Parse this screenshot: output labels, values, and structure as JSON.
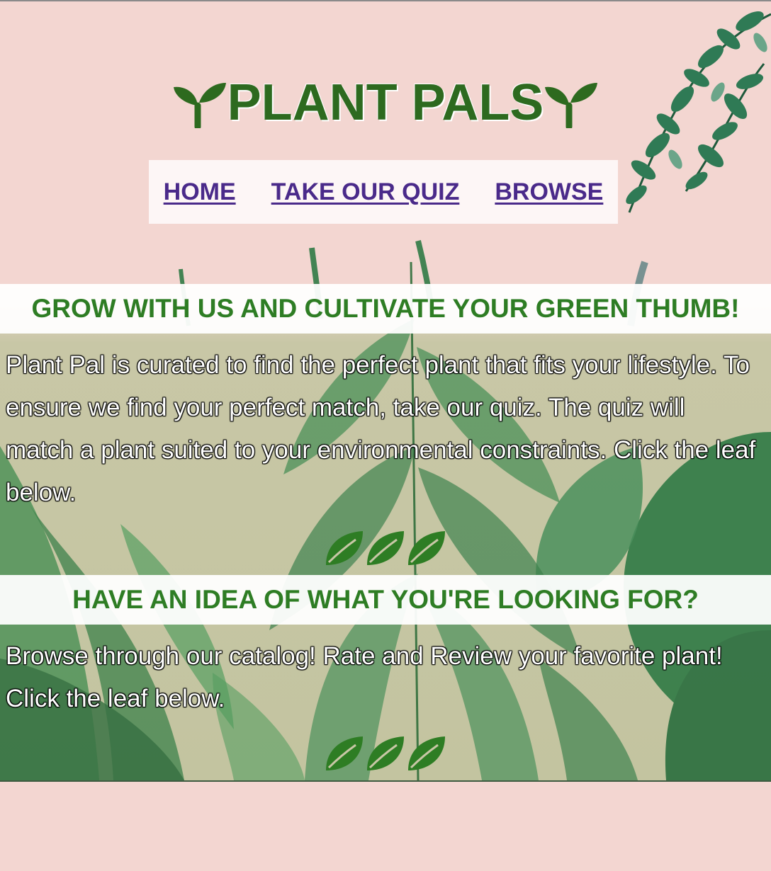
{
  "brand": {
    "title": "PLANT PALS",
    "left_icon": "sprout-icon",
    "right_icon": "sprout-icon"
  },
  "nav": {
    "items": [
      {
        "label": "HOME"
      },
      {
        "label": "TAKE OUR QUIZ"
      },
      {
        "label": "BROWSE"
      }
    ]
  },
  "quiz_section": {
    "heading": "GROW WITH US AND CULTIVATE YOUR GREEN THUMB!",
    "body": "Plant Pal is curated to find the perfect plant that fits your lifestyle. To ensure we find your perfect match, take our quiz. The quiz will match a plant suited to your environmental constraints. Click the leaf below.",
    "link_icon": "leaf-icon"
  },
  "browse_section": {
    "heading": "HAVE AN IDEA OF WHAT YOU'RE LOOKING FOR?",
    "body": "Browse through our catalog! Rate and Review your favorite plant! Click the leaf below.",
    "link_icon": "leaf-icon"
  },
  "colors": {
    "brand_green": "#2d6a1f",
    "heading_green": "#2e7d24",
    "nav_link": "#4a2a8a",
    "page_pink": "#f3d6d1"
  }
}
